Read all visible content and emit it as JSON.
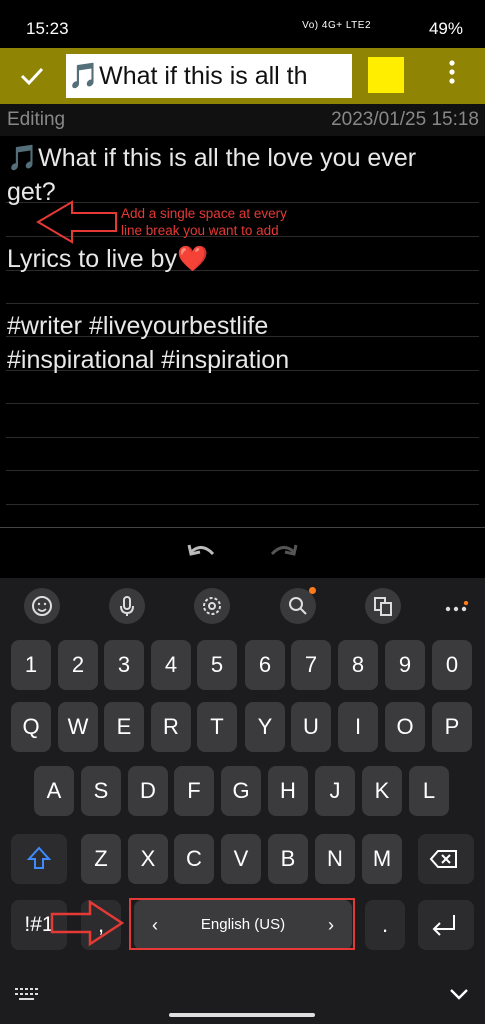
{
  "status": {
    "time": "15:23",
    "indicators": "Vo) 4G+ LTE2",
    "battery": "49%"
  },
  "toolbar": {
    "confirm_icon": "check-icon",
    "title": "🎵What if this is all th",
    "color": "#ffee00",
    "more_icon": "more-vert-icon"
  },
  "meta": {
    "state": "Editing",
    "date": "2023/01/25 15:18"
  },
  "note": {
    "lines": [
      "🎵What if this is all the love you ever",
      "get?",
      "",
      "Lyrics to live by❤️",
      "",
      "#writer #liveyourbestlife",
      "#inspirational #inspiration"
    ]
  },
  "annotation": {
    "text_line1": "Add a single space at every",
    "text_line2": "line break you want to add",
    "color": "#e53935"
  },
  "editor_actions": {
    "undo_icon": "undo-icon",
    "redo_icon": "redo-icon"
  },
  "keyboard": {
    "toolbar_icons": [
      "emoji-icon",
      "mic-icon",
      "settings-icon",
      "search-icon",
      "translate-icon",
      "more-horiz-icon"
    ],
    "row_numbers": [
      "1",
      "2",
      "3",
      "4",
      "5",
      "6",
      "7",
      "8",
      "9",
      "0"
    ],
    "row_q": [
      "Q",
      "W",
      "E",
      "R",
      "T",
      "Y",
      "U",
      "I",
      "O",
      "P"
    ],
    "row_a": [
      "A",
      "S",
      "D",
      "F",
      "G",
      "H",
      "J",
      "K",
      "L"
    ],
    "row_z": [
      "Z",
      "X",
      "C",
      "V",
      "B",
      "N",
      "M"
    ],
    "shift_icon": "shift-icon",
    "backspace_icon": "backspace-icon",
    "symbols_label": "!#1",
    "comma": ",",
    "space_label": "English (US)",
    "period": ".",
    "enter_icon": "enter-icon",
    "hide_icon": "chevron-down-icon",
    "kb_switch_icon": "keyboard-icon"
  }
}
